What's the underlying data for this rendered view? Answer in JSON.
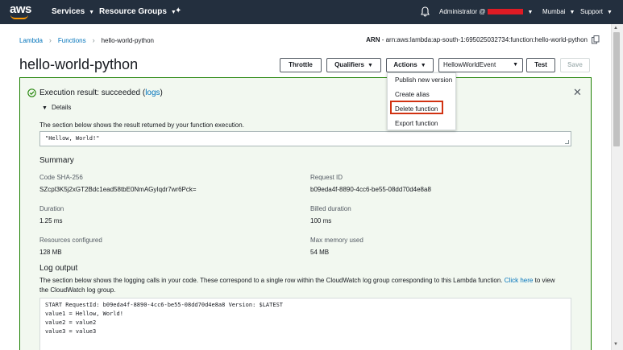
{
  "topnav": {
    "logo_text": "aws",
    "services_label": "Services",
    "resource_groups_label": "Resource Groups",
    "account_label": "Administrator @",
    "region_label": "Mumbai",
    "support_label": "Support"
  },
  "breadcrumb": {
    "lambda": "Lambda",
    "functions": "Functions",
    "current": "hello-world-python"
  },
  "arn": {
    "label": "ARN",
    "value": "- arn:aws:lambda:ap-south-1:695025032734:function:hello-world-python"
  },
  "page": {
    "title": "hello-world-python"
  },
  "toolbar": {
    "throttle": "Throttle",
    "qualifiers": "Qualifiers",
    "actions": "Actions",
    "test_event": "HellowWorldEvent",
    "test": "Test",
    "save": "Save"
  },
  "actions_menu": {
    "items": [
      "Publish new version",
      "Create alias",
      "Delete function",
      "Export function"
    ]
  },
  "result": {
    "title_prefix": "Execution result: succeeded (",
    "logs_link": "logs",
    "title_suffix": ")",
    "details_label": "Details",
    "description": "The section below shows the result returned by your function execution.",
    "output": "\"Hellow, World!\""
  },
  "summary": {
    "heading": "Summary",
    "fields": [
      {
        "label": "Code SHA-256",
        "value": "SZcpl3K5j2xGT2Bdc1ead58tbE0NmAGyIqdr7wr6Pck="
      },
      {
        "label": "Request ID",
        "value": "b09eda4f-8890-4cc6-be55-08dd70d4e8a8"
      },
      {
        "label": "Duration",
        "value": "1.25 ms"
      },
      {
        "label": "Billed duration",
        "value": "100 ms"
      },
      {
        "label": "Resources configured",
        "value": "128 MB"
      },
      {
        "label": "Max memory used",
        "value": "54 MB"
      }
    ]
  },
  "log_output": {
    "heading": "Log output",
    "description_pre": "The section below shows the logging calls in your code. These correspond to a single row within the CloudWatch log group corresponding to this Lambda function.",
    "click_here": "Click here",
    "description_post": "to view the CloudWatch log group.",
    "lines": [
      "START RequestId: b09eda4f-8890-4cc6-be55-08dd70d4e8a8 Version: $LATEST",
      "value1 = Hellow, World!",
      "value2 = value2",
      "value3 = value3"
    ]
  },
  "colors": {
    "nav_bg": "#232f3e",
    "success": "#1d8102",
    "link": "#0073bb",
    "highlight": "#d13212"
  }
}
